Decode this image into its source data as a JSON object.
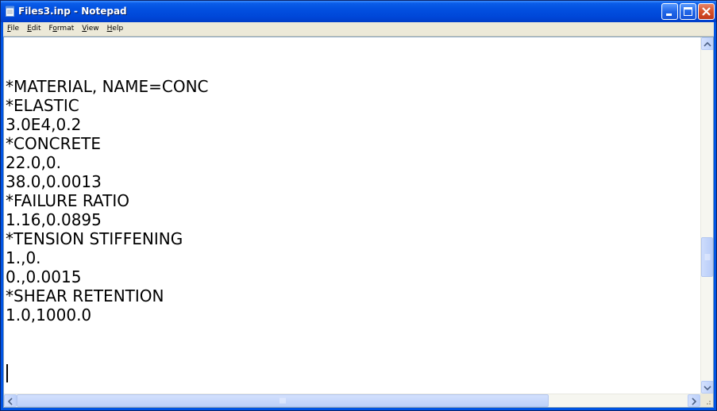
{
  "window": {
    "title": "Files3.inp - Notepad",
    "icon": "notepad-icon"
  },
  "title_controls": {
    "minimize_icon": "minimize-icon",
    "maximize_icon": "maximize-icon",
    "close_icon": "close-icon"
  },
  "menu": {
    "items": [
      {
        "label": "File",
        "access_key": "F",
        "rest": "ile"
      },
      {
        "label": "Edit",
        "access_key": "E",
        "rest": "dit"
      },
      {
        "label": "Format",
        "access_key": "o",
        "prefix": "F",
        "rest": "rmat"
      },
      {
        "label": "View",
        "access_key": "V",
        "rest": "iew"
      },
      {
        "label": "Help",
        "access_key": "H",
        "rest": "elp"
      }
    ]
  },
  "editor": {
    "lines": [
      "*MATERIAL, NAME=CONC",
      "*ELASTIC",
      "3.0E4,0.2",
      "*CONCRETE",
      "22.0,0.",
      "38.0,0.0013",
      "*FAILURE RATIO",
      "1.16,0.0895",
      "*TENSION STIFFENING",
      "1.,0.",
      "0.,0.0015",
      "*SHEAR RETENTION",
      "1.0,1000.0"
    ]
  },
  "scrollbars": {
    "vertical_position": 0.55,
    "horizontal_position": 0.0
  },
  "colors": {
    "titlebar": "#0054e3",
    "close_button": "#d8542c",
    "menubar": "#ece9d8",
    "scrollbar_thumb": "#c1d3fb"
  }
}
